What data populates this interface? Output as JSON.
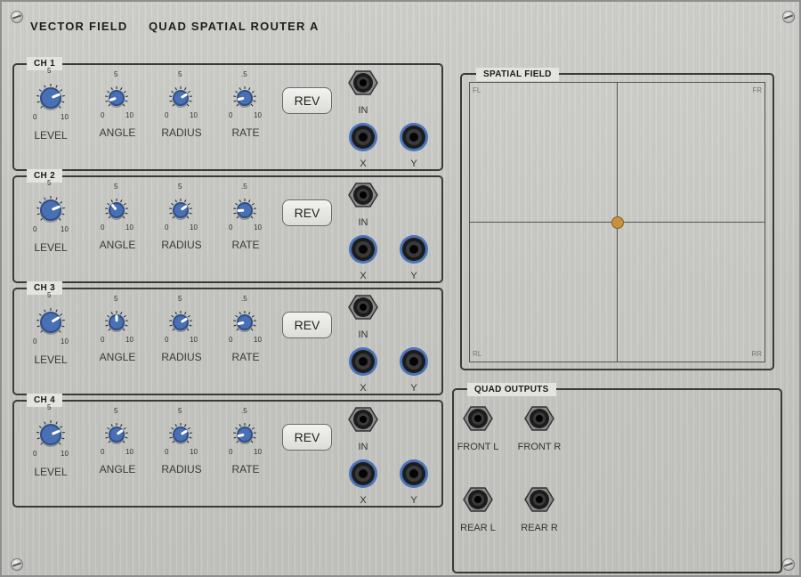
{
  "header": {
    "title_left": "VECTOR FIELD",
    "title_right": "QUAD SPATIAL ROUTER  A"
  },
  "channels": [
    {
      "label": "CH 1",
      "level": 0.75,
      "angle": 0.1,
      "radius": 0.72,
      "rate": 0.12
    },
    {
      "label": "CH 2",
      "level": 0.75,
      "angle": 0.35,
      "radius": 0.7,
      "rate": 0.15
    },
    {
      "label": "CH 3",
      "level": 0.72,
      "angle": 0.5,
      "radius": 0.72,
      "rate": 0.12
    },
    {
      "label": "CH 4",
      "level": 0.75,
      "angle": 0.7,
      "radius": 0.72,
      "rate": 0.12
    }
  ],
  "knob_labels": {
    "level": "LEVEL",
    "angle": "ANGLE",
    "radius": "RADIUS",
    "rate": "RATE"
  },
  "ticks": {
    "min": "0",
    "max": "10",
    "mid": "5",
    "rate_mid": ".5"
  },
  "rev_label": "REV",
  "jack_labels": {
    "in": "IN",
    "x": "X",
    "y": "Y"
  },
  "spatial": {
    "label": "SPATIAL FIELD",
    "fl": "FL",
    "fr": "FR",
    "rl": "RL",
    "rr": "RR",
    "puck_x": 0.5,
    "puck_y": 0.5
  },
  "outputs": {
    "label": "QUAD OUTPUTS",
    "front_l": "FRONT L",
    "front_r": "FRONT R",
    "rear_l": "REAR L",
    "rear_r": "REAR R"
  },
  "colors": {
    "knob": "#3f64a8",
    "jack_ring": "#4a73b8",
    "puck": "#c8913f"
  }
}
